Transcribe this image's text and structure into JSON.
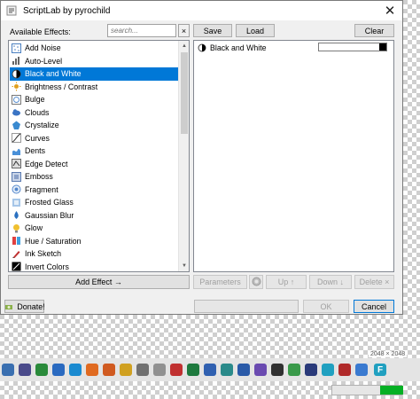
{
  "window": {
    "title": "ScriptLab by pyrochild",
    "close_glyph": "✕"
  },
  "effects_panel": {
    "label": "Available Effects:",
    "search_placeholder": "search...",
    "clear_search_glyph": "×",
    "items": [
      {
        "label": "Add Noise",
        "icon": "noise-icon",
        "color": "#4a7fc0",
        "selected": false
      },
      {
        "label": "Auto-Level",
        "icon": "auto-level-icon",
        "color": "#6b6b6b",
        "selected": false
      },
      {
        "label": "Black and White",
        "icon": "black-white-icon",
        "color": "#000000",
        "selected": true
      },
      {
        "label": "Brightness / Contrast",
        "icon": "brightness-icon",
        "color": "#e0a020",
        "selected": false
      },
      {
        "label": "Bulge",
        "icon": "bulge-icon",
        "color": "#5a8fd0",
        "selected": false
      },
      {
        "label": "Clouds",
        "icon": "clouds-icon",
        "color": "#3a74c4",
        "selected": false
      },
      {
        "label": "Crystalize",
        "icon": "crystalize-icon",
        "color": "#3a8ad0",
        "selected": false
      },
      {
        "label": "Curves",
        "icon": "curves-icon",
        "color": "#707070",
        "selected": false
      },
      {
        "label": "Dents",
        "icon": "dents-icon",
        "color": "#4a90d8",
        "selected": false
      },
      {
        "label": "Edge Detect",
        "icon": "edge-detect-icon",
        "color": "#6a6a6a",
        "selected": false
      },
      {
        "label": "Emboss",
        "icon": "emboss-icon",
        "color": "#5a7ab0",
        "selected": false
      },
      {
        "label": "Fragment",
        "icon": "fragment-icon",
        "color": "#5588cc",
        "selected": false
      },
      {
        "label": "Frosted Glass",
        "icon": "frosted-glass-icon",
        "color": "#6aa0d8",
        "selected": false
      },
      {
        "label": "Gaussian Blur",
        "icon": "gaussian-blur-icon",
        "color": "#2a70c0",
        "selected": false
      },
      {
        "label": "Glow",
        "icon": "glow-icon",
        "color": "#f0c030",
        "selected": false
      },
      {
        "label": "Hue / Saturation",
        "icon": "hue-saturation-icon",
        "color": "#d04040",
        "selected": false
      },
      {
        "label": "Ink Sketch",
        "icon": "ink-sketch-icon",
        "color": "#c03030",
        "selected": false
      },
      {
        "label": "Invert Colors",
        "icon": "invert-colors-icon",
        "color": "#000000",
        "selected": false
      }
    ],
    "add_effect_label": "Add Effect →",
    "donate_label": "Donate!"
  },
  "chain_panel": {
    "save_label": "Save",
    "load_label": "Load",
    "clear_label": "Clear",
    "rows": [
      {
        "label": "Black and White",
        "icon": "black-white-icon"
      }
    ],
    "parameters_label": "Parameters",
    "up_label": "Up ↑",
    "down_label": "Down ↓",
    "delete_label": "Delete ×",
    "ok_label": "OK",
    "cancel_label": "Cancel"
  },
  "background": {
    "dimension_text": "2048 × 2048"
  },
  "taskbar": {
    "icons": [
      {
        "name": "file-icon",
        "color": "#3a6fb0"
      },
      {
        "name": "chat-icon",
        "color": "#4a4a8a"
      },
      {
        "name": "image-icon",
        "color": "#2a8a3a"
      },
      {
        "name": "mail-icon",
        "color": "#2a6ac0"
      },
      {
        "name": "edge-icon",
        "color": "#1a8ad0"
      },
      {
        "name": "firefox-icon",
        "color": "#e06a20"
      },
      {
        "name": "app-orange-icon",
        "color": "#d05a20"
      },
      {
        "name": "chrome-icon",
        "color": "#d0a020"
      },
      {
        "name": "settings-icon",
        "color": "#707070"
      },
      {
        "name": "app-gray-icon",
        "color": "#909090"
      },
      {
        "name": "app-red-icon",
        "color": "#c03030"
      },
      {
        "name": "excel-icon",
        "color": "#1e7a3e"
      },
      {
        "name": "app-blue-icon",
        "color": "#3060b0"
      },
      {
        "name": "app-teal-icon",
        "color": "#2a8a8a"
      },
      {
        "name": "word-icon",
        "color": "#2a5aa8"
      },
      {
        "name": "app-purple-icon",
        "color": "#6a4ab0"
      },
      {
        "name": "app-dark-icon",
        "color": "#303030"
      },
      {
        "name": "app-green-icon",
        "color": "#3a9a4a"
      },
      {
        "name": "app-navy-icon",
        "color": "#2a3a7a"
      },
      {
        "name": "app-cyan-icon",
        "color": "#20a0c0"
      },
      {
        "name": "app-red2-icon",
        "color": "#b02a2a"
      },
      {
        "name": "app-blue2-icon",
        "color": "#3a7ad0"
      }
    ],
    "pinned_letter": "F",
    "pinned_color": "#20a0c0"
  },
  "status": {
    "progress_fraction": 0.33,
    "accent": "#06b025"
  }
}
